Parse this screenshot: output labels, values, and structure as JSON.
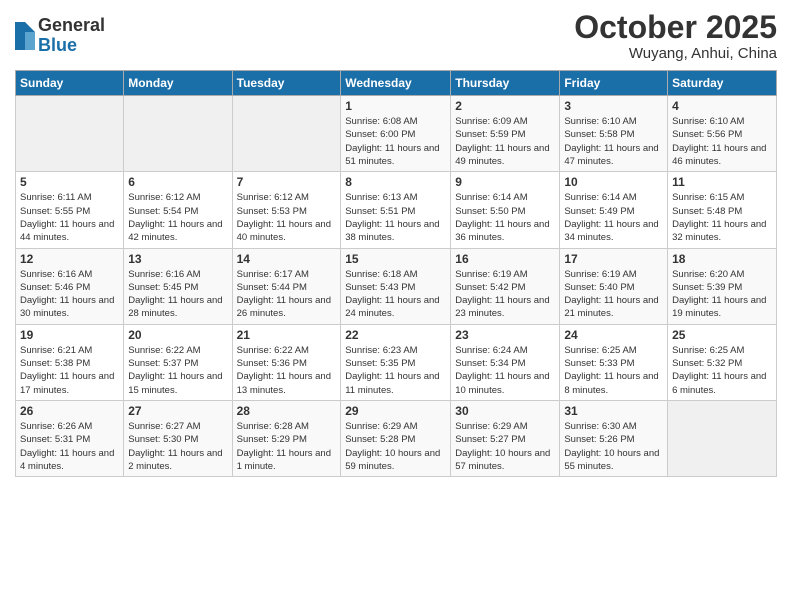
{
  "header": {
    "logo_general": "General",
    "logo_blue": "Blue",
    "month": "October 2025",
    "location": "Wuyang, Anhui, China"
  },
  "days_of_week": [
    "Sunday",
    "Monday",
    "Tuesday",
    "Wednesday",
    "Thursday",
    "Friday",
    "Saturday"
  ],
  "weeks": [
    [
      {
        "day": "",
        "info": ""
      },
      {
        "day": "",
        "info": ""
      },
      {
        "day": "",
        "info": ""
      },
      {
        "day": "1",
        "info": "Sunrise: 6:08 AM\nSunset: 6:00 PM\nDaylight: 11 hours\nand 51 minutes."
      },
      {
        "day": "2",
        "info": "Sunrise: 6:09 AM\nSunset: 5:59 PM\nDaylight: 11 hours\nand 49 minutes."
      },
      {
        "day": "3",
        "info": "Sunrise: 6:10 AM\nSunset: 5:58 PM\nDaylight: 11 hours\nand 47 minutes."
      },
      {
        "day": "4",
        "info": "Sunrise: 6:10 AM\nSunset: 5:56 PM\nDaylight: 11 hours\nand 46 minutes."
      }
    ],
    [
      {
        "day": "5",
        "info": "Sunrise: 6:11 AM\nSunset: 5:55 PM\nDaylight: 11 hours\nand 44 minutes."
      },
      {
        "day": "6",
        "info": "Sunrise: 6:12 AM\nSunset: 5:54 PM\nDaylight: 11 hours\nand 42 minutes."
      },
      {
        "day": "7",
        "info": "Sunrise: 6:12 AM\nSunset: 5:53 PM\nDaylight: 11 hours\nand 40 minutes."
      },
      {
        "day": "8",
        "info": "Sunrise: 6:13 AM\nSunset: 5:51 PM\nDaylight: 11 hours\nand 38 minutes."
      },
      {
        "day": "9",
        "info": "Sunrise: 6:14 AM\nSunset: 5:50 PM\nDaylight: 11 hours\nand 36 minutes."
      },
      {
        "day": "10",
        "info": "Sunrise: 6:14 AM\nSunset: 5:49 PM\nDaylight: 11 hours\nand 34 minutes."
      },
      {
        "day": "11",
        "info": "Sunrise: 6:15 AM\nSunset: 5:48 PM\nDaylight: 11 hours\nand 32 minutes."
      }
    ],
    [
      {
        "day": "12",
        "info": "Sunrise: 6:16 AM\nSunset: 5:46 PM\nDaylight: 11 hours\nand 30 minutes."
      },
      {
        "day": "13",
        "info": "Sunrise: 6:16 AM\nSunset: 5:45 PM\nDaylight: 11 hours\nand 28 minutes."
      },
      {
        "day": "14",
        "info": "Sunrise: 6:17 AM\nSunset: 5:44 PM\nDaylight: 11 hours\nand 26 minutes."
      },
      {
        "day": "15",
        "info": "Sunrise: 6:18 AM\nSunset: 5:43 PM\nDaylight: 11 hours\nand 24 minutes."
      },
      {
        "day": "16",
        "info": "Sunrise: 6:19 AM\nSunset: 5:42 PM\nDaylight: 11 hours\nand 23 minutes."
      },
      {
        "day": "17",
        "info": "Sunrise: 6:19 AM\nSunset: 5:40 PM\nDaylight: 11 hours\nand 21 minutes."
      },
      {
        "day": "18",
        "info": "Sunrise: 6:20 AM\nSunset: 5:39 PM\nDaylight: 11 hours\nand 19 minutes."
      }
    ],
    [
      {
        "day": "19",
        "info": "Sunrise: 6:21 AM\nSunset: 5:38 PM\nDaylight: 11 hours\nand 17 minutes."
      },
      {
        "day": "20",
        "info": "Sunrise: 6:22 AM\nSunset: 5:37 PM\nDaylight: 11 hours\nand 15 minutes."
      },
      {
        "day": "21",
        "info": "Sunrise: 6:22 AM\nSunset: 5:36 PM\nDaylight: 11 hours\nand 13 minutes."
      },
      {
        "day": "22",
        "info": "Sunrise: 6:23 AM\nSunset: 5:35 PM\nDaylight: 11 hours\nand 11 minutes."
      },
      {
        "day": "23",
        "info": "Sunrise: 6:24 AM\nSunset: 5:34 PM\nDaylight: 11 hours\nand 10 minutes."
      },
      {
        "day": "24",
        "info": "Sunrise: 6:25 AM\nSunset: 5:33 PM\nDaylight: 11 hours\nand 8 minutes."
      },
      {
        "day": "25",
        "info": "Sunrise: 6:25 AM\nSunset: 5:32 PM\nDaylight: 11 hours\nand 6 minutes."
      }
    ],
    [
      {
        "day": "26",
        "info": "Sunrise: 6:26 AM\nSunset: 5:31 PM\nDaylight: 11 hours\nand 4 minutes."
      },
      {
        "day": "27",
        "info": "Sunrise: 6:27 AM\nSunset: 5:30 PM\nDaylight: 11 hours\nand 2 minutes."
      },
      {
        "day": "28",
        "info": "Sunrise: 6:28 AM\nSunset: 5:29 PM\nDaylight: 11 hours\nand 1 minute."
      },
      {
        "day": "29",
        "info": "Sunrise: 6:29 AM\nSunset: 5:28 PM\nDaylight: 10 hours\nand 59 minutes."
      },
      {
        "day": "30",
        "info": "Sunrise: 6:29 AM\nSunset: 5:27 PM\nDaylight: 10 hours\nand 57 minutes."
      },
      {
        "day": "31",
        "info": "Sunrise: 6:30 AM\nSunset: 5:26 PM\nDaylight: 10 hours\nand 55 minutes."
      },
      {
        "day": "",
        "info": ""
      }
    ]
  ]
}
